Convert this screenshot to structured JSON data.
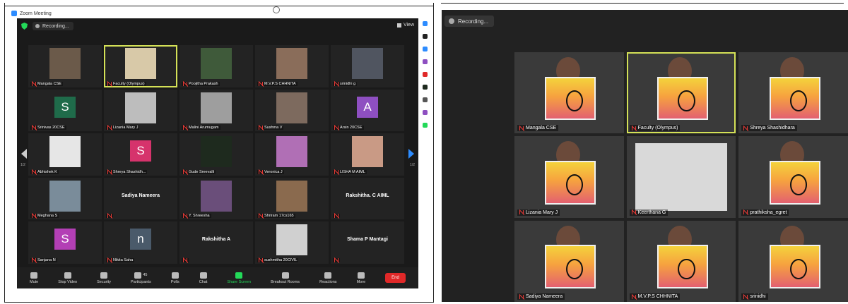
{
  "left_window": {
    "title": "Zoom Meeting",
    "recording_label": "Recording...",
    "view_label": "View",
    "page_left": "1/2",
    "page_right": "1/2",
    "participants": [
      {
        "name": "Mangala CSE",
        "kind": "video",
        "color": "#6b5a4a"
      },
      {
        "name": "Faculty (Olympus)",
        "kind": "video",
        "color": "#d8c9a8",
        "active": true
      },
      {
        "name": "Poojitha Prakash",
        "kind": "video",
        "color": "#3f5a3a"
      },
      {
        "name": "M.V.P.S CHHNITA",
        "kind": "video",
        "color": "#8a6d5a"
      },
      {
        "name": "srinidhi g",
        "kind": "video",
        "color": "#505560"
      },
      {
        "name": "Srinivas 20CSE",
        "kind": "avatar",
        "letter": "S",
        "color": "#1f6b4a"
      },
      {
        "name": "Lizania Mary J",
        "kind": "video",
        "color": "#bdbdbd"
      },
      {
        "name": "Malini Arumugam",
        "kind": "video",
        "color": "#9e9e9e"
      },
      {
        "name": "Sushma V",
        "kind": "video",
        "color": "#7d6a5e"
      },
      {
        "name": "Arsin 20CSE",
        "kind": "avatar",
        "letter": "A",
        "color": "#8e4fc1"
      },
      {
        "name": "Abhishek K",
        "kind": "video",
        "color": "#e6e6e6"
      },
      {
        "name": "Shreya Shashidh...",
        "kind": "avatar",
        "letter": "S",
        "color": "#d6336c"
      },
      {
        "name": "Gude Sreevalli",
        "kind": "video",
        "color": "#1e2a1e"
      },
      {
        "name": "Veronica J",
        "kind": "video",
        "color": "#b06fb5"
      },
      {
        "name": "LISHA M AIML",
        "kind": "video",
        "color": "#c99a85"
      },
      {
        "name": "Meghana S",
        "kind": "video",
        "color": "#7a8c9a"
      },
      {
        "name": "Sadiya Nameera",
        "kind": "name",
        "color": "#232323"
      },
      {
        "name": "Y. Shreesha",
        "kind": "video",
        "color": "#6a4e7a"
      },
      {
        "name": "Shriram 17cs165",
        "kind": "video",
        "color": "#8a6a4e"
      },
      {
        "name": "Rakshitha. C AIML",
        "kind": "name",
        "color": "#232323"
      },
      {
        "name": "Sanjana N",
        "kind": "avatar",
        "letter": "S",
        "color": "#b33fb5"
      },
      {
        "name": "Nikita Saha",
        "kind": "avatar",
        "letter": "n",
        "color": "#4a5a6a"
      },
      {
        "name": "Rakshitha A",
        "kind": "name",
        "color": "#232323"
      },
      {
        "name": "sushmitha 20CIVIL",
        "kind": "video",
        "color": "#d0d0d0"
      },
      {
        "name": "Shama P Mantagi",
        "kind": "name",
        "color": "#232323"
      }
    ],
    "toolbar": {
      "mute": "Mute",
      "stop_video": "Stop Video",
      "security": "Security",
      "participants": "Participants",
      "participants_count": "45",
      "polls": "Polls",
      "chat": "Chat",
      "share_screen": "Share Screen",
      "breakout_rooms": "Breakout Rooms",
      "reactions": "Reactions",
      "more": "More",
      "end": "End"
    }
  },
  "right_window": {
    "recording_label": "Recording...",
    "tiles": [
      {
        "name": "Mangala CSE",
        "scene": "person",
        "active": false
      },
      {
        "name": "Faculty (Olympus)",
        "scene": "painting",
        "active": true
      },
      {
        "name": "Shreya Shashidhara",
        "scene": "painting",
        "active": false
      },
      {
        "name": "Lizania Mary J",
        "scene": "painting",
        "active": false
      },
      {
        "name": "Keerthana G",
        "scene": "sketch",
        "active": false
      },
      {
        "name": "prathiksha_egret",
        "scene": "painting",
        "active": false
      },
      {
        "name": "Sadiya Nameera",
        "scene": "painting",
        "active": false
      },
      {
        "name": "M.V.P.S CHHNITA",
        "scene": "painting",
        "active": false
      },
      {
        "name": "srinidhi",
        "scene": "painting",
        "active": false
      }
    ]
  }
}
